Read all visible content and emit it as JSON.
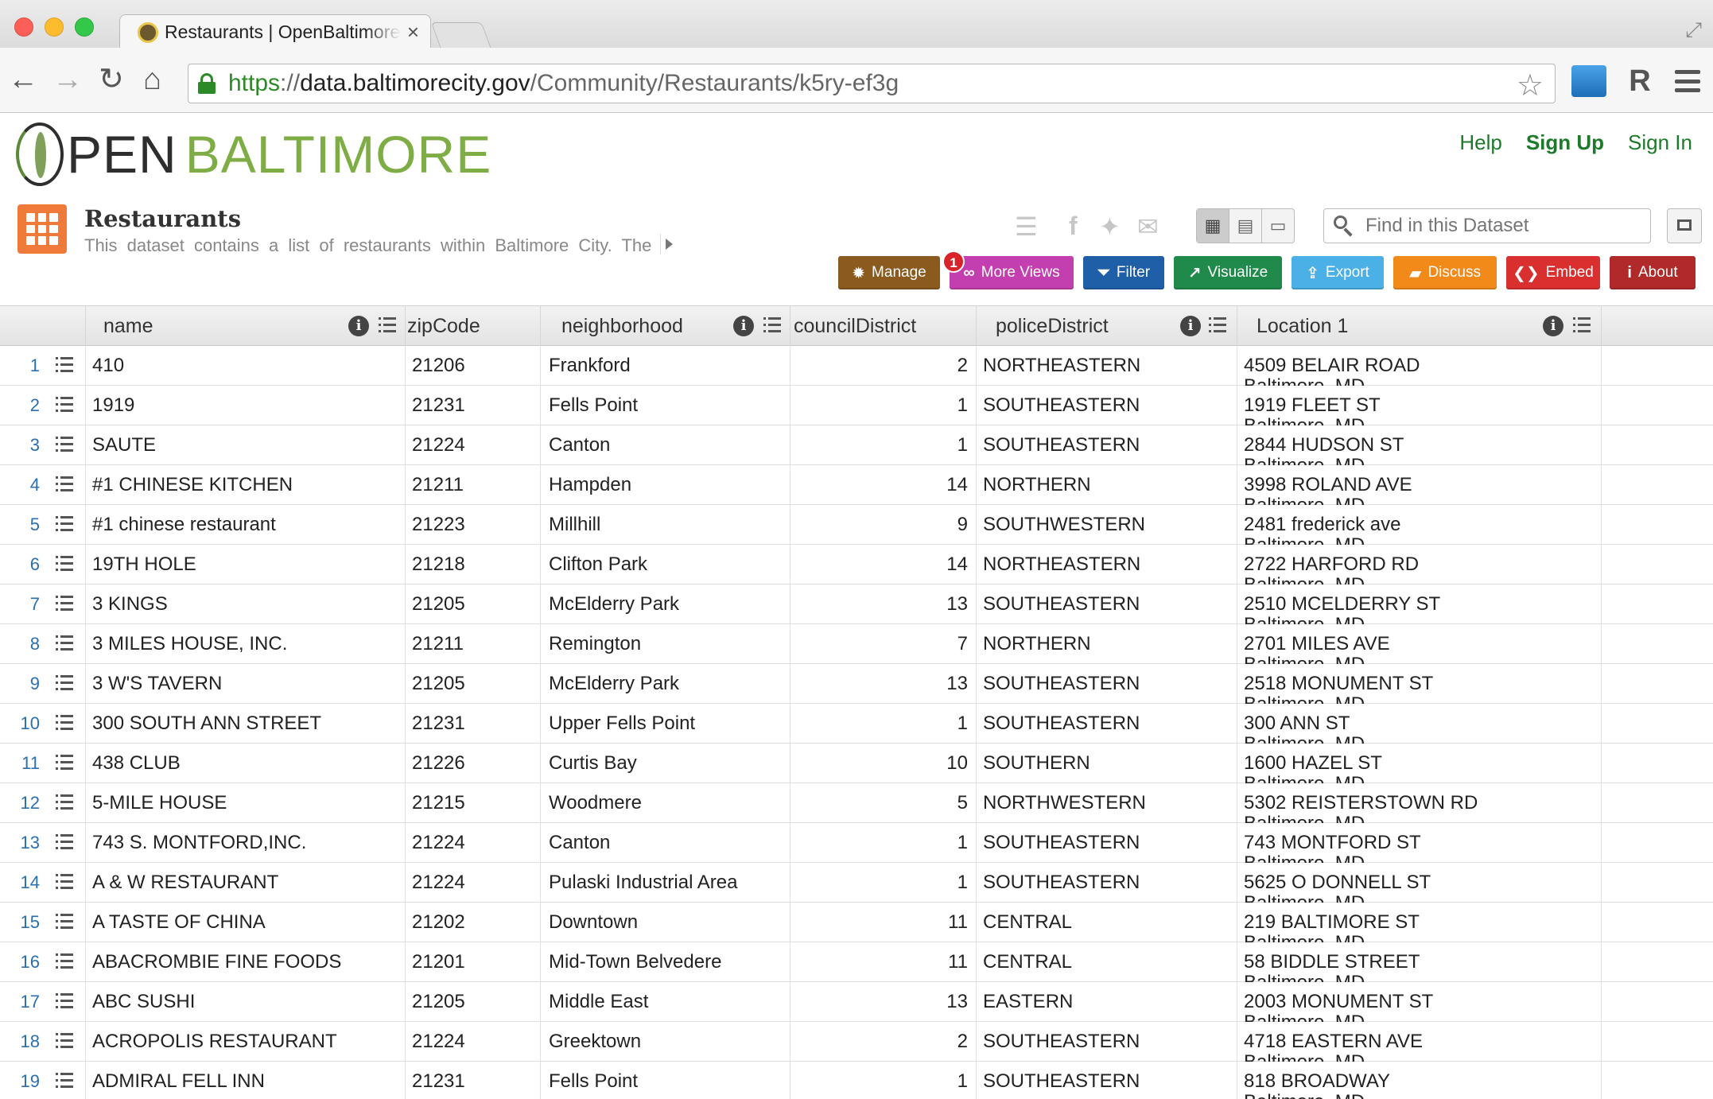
{
  "browser": {
    "tab_title": "Restaurants | OpenBaltimore",
    "tab_close": "×",
    "url_scheme": "https",
    "url_sep": "://",
    "url_host": "data.baltimorecity.gov",
    "url_path": "/Community/Restaurants/k5ry-ef3g",
    "back": "←",
    "forward": "→",
    "reload": "↻",
    "home": "⌂",
    "star": "☆"
  },
  "site": {
    "logo_open": "PEN",
    "logo_baltimore": "BALTIMORE",
    "links": {
      "help": "Help",
      "signup": "Sign Up",
      "signin": "Sign In"
    }
  },
  "dataset": {
    "title": "Restaurants",
    "description": "This dataset contains a list of restaurants within Baltimore City. The",
    "search_placeholder": "Find in this Dataset",
    "more_views_count": "1",
    "actions": [
      {
        "label": "Manage",
        "color": "#8a5a1e",
        "icon": "gear-icon",
        "glyph": "✹"
      },
      {
        "label": "More Views",
        "color": "#c33fb0",
        "icon": "binoculars-icon",
        "glyph": "∞"
      },
      {
        "label": "Filter",
        "color": "#1f5fa8",
        "icon": "funnel-icon",
        "glyph": "⏷"
      },
      {
        "label": "Visualize",
        "color": "#1f8a4a",
        "icon": "chart-icon",
        "glyph": "↗"
      },
      {
        "label": "Export",
        "color": "#4ab0e6",
        "icon": "export-icon",
        "glyph": "⇪"
      },
      {
        "label": "Discuss",
        "color": "#f28a1a",
        "icon": "speech-bubble-icon",
        "glyph": "▰"
      },
      {
        "label": "Embed",
        "color": "#d9302f",
        "icon": "embed-icon",
        "glyph": "❮❯"
      },
      {
        "label": "About",
        "color": "#b02a2a",
        "icon": "info-icon",
        "glyph": "i"
      }
    ]
  },
  "grid": {
    "columns": [
      "name",
      "zipCode",
      "neighborhood",
      "councilDistrict",
      "policeDistrict",
      "Location 1"
    ],
    "location_second_line": "Baltimore, MD",
    "rows": [
      {
        "n": "1",
        "name": "410",
        "zip": "21206",
        "hood": "Frankford",
        "council": "2",
        "police": "NORTHEASTERN",
        "loc": "4509 BELAIR ROAD"
      },
      {
        "n": "2",
        "name": "1919",
        "zip": "21231",
        "hood": "Fells Point",
        "council": "1",
        "police": "SOUTHEASTERN",
        "loc": "1919 FLEET ST"
      },
      {
        "n": "3",
        "name": "SAUTE",
        "zip": "21224",
        "hood": "Canton",
        "council": "1",
        "police": "SOUTHEASTERN",
        "loc": "2844 HUDSON ST"
      },
      {
        "n": "4",
        "name": "#1 CHINESE KITCHEN",
        "zip": "21211",
        "hood": "Hampden",
        "council": "14",
        "police": "NORTHERN",
        "loc": "3998 ROLAND AVE"
      },
      {
        "n": "5",
        "name": "#1 chinese restaurant",
        "zip": "21223",
        "hood": "Millhill",
        "council": "9",
        "police": "SOUTHWESTERN",
        "loc": "2481 frederick ave"
      },
      {
        "n": "6",
        "name": "19TH HOLE",
        "zip": "21218",
        "hood": "Clifton Park",
        "council": "14",
        "police": "NORTHEASTERN",
        "loc": "2722 HARFORD RD"
      },
      {
        "n": "7",
        "name": "3 KINGS",
        "zip": "21205",
        "hood": "McElderry Park",
        "council": "13",
        "police": "SOUTHEASTERN",
        "loc": "2510 MCELDERRY ST"
      },
      {
        "n": "8",
        "name": "3 MILES HOUSE, INC.",
        "zip": "21211",
        "hood": "Remington",
        "council": "7",
        "police": "NORTHERN",
        "loc": "2701 MILES AVE"
      },
      {
        "n": "9",
        "name": "3 W'S TAVERN",
        "zip": "21205",
        "hood": "McElderry Park",
        "council": "13",
        "police": "SOUTHEASTERN",
        "loc": "2518 MONUMENT ST"
      },
      {
        "n": "10",
        "name": "300 SOUTH ANN STREET",
        "zip": "21231",
        "hood": "Upper Fells Point",
        "council": "1",
        "police": "SOUTHEASTERN",
        "loc": "300 ANN ST"
      },
      {
        "n": "11",
        "name": "438 CLUB",
        "zip": "21226",
        "hood": "Curtis Bay",
        "council": "10",
        "police": "SOUTHERN",
        "loc": "1600 HAZEL ST"
      },
      {
        "n": "12",
        "name": "5-MILE HOUSE",
        "zip": "21215",
        "hood": "Woodmere",
        "council": "5",
        "police": "NORTHWESTERN",
        "loc": "5302 REISTERSTOWN RD"
      },
      {
        "n": "13",
        "name": "743 S. MONTFORD,INC.",
        "zip": "21224",
        "hood": "Canton",
        "council": "1",
        "police": "SOUTHEASTERN",
        "loc": "743 MONTFORD ST"
      },
      {
        "n": "14",
        "name": "A & W RESTAURANT",
        "zip": "21224",
        "hood": "Pulaski Industrial Area",
        "council": "1",
        "police": "SOUTHEASTERN",
        "loc": "5625 O DONNELL ST"
      },
      {
        "n": "15",
        "name": "A TASTE OF CHINA",
        "zip": "21202",
        "hood": "Downtown",
        "council": "11",
        "police": "CENTRAL",
        "loc": "219 BALTIMORE ST"
      },
      {
        "n": "16",
        "name": "ABACROMBIE FINE FOODS",
        "zip": "21201",
        "hood": "Mid-Town Belvedere",
        "council": "11",
        "police": "CENTRAL",
        "loc": "58 BIDDLE STREET"
      },
      {
        "n": "17",
        "name": "ABC SUSHI",
        "zip": "21205",
        "hood": "Middle East",
        "council": "13",
        "police": "EASTERN",
        "loc": "2003 MONUMENT ST"
      },
      {
        "n": "18",
        "name": "ACROPOLIS RESTAURANT",
        "zip": "21224",
        "hood": "Greektown",
        "council": "2",
        "police": "SOUTHEASTERN",
        "loc": "4718 EASTERN AVE"
      },
      {
        "n": "19",
        "name": "ADMIRAL FELL INN",
        "zip": "21231",
        "hood": "Fells Point",
        "council": "1",
        "police": "SOUTHEASTERN",
        "loc": "818 BROADWAY"
      }
    ]
  }
}
